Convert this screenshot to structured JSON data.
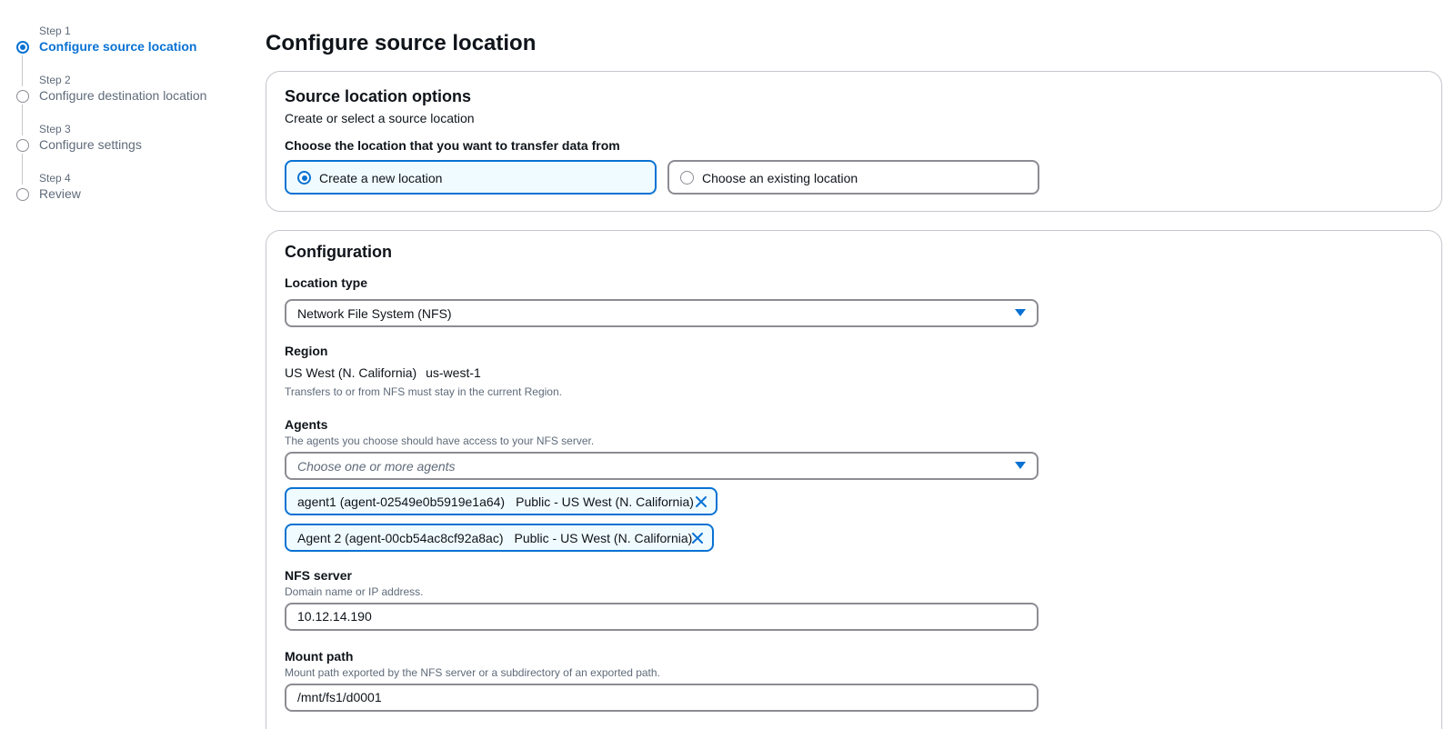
{
  "wizard": {
    "steps": [
      {
        "number": "Step 1",
        "title": "Configure source location",
        "active": true
      },
      {
        "number": "Step 2",
        "title": "Configure destination location",
        "active": false
      },
      {
        "number": "Step 3",
        "title": "Configure settings",
        "active": false
      },
      {
        "number": "Step 4",
        "title": "Review",
        "active": false
      }
    ]
  },
  "page": {
    "title": "Configure source location"
  },
  "source_options": {
    "header": "Source location options",
    "description": "Create or select a source location",
    "choice_label": "Choose the location that you want to transfer data from",
    "tiles": [
      {
        "label": "Create a new location",
        "selected": true
      },
      {
        "label": "Choose an existing location",
        "selected": false
      }
    ]
  },
  "configuration": {
    "header": "Configuration",
    "location_type": {
      "label": "Location type",
      "value": "Network File System (NFS)"
    },
    "region": {
      "label": "Region",
      "name": "US West (N. California)",
      "code": "us-west-1",
      "hint": "Transfers to or from NFS must stay in the current Region."
    },
    "agents": {
      "label": "Agents",
      "hint": "The agents you choose should have access to your NFS server.",
      "placeholder": "Choose one or more agents",
      "tokens": [
        {
          "label": "agent1 (agent-02549e0b5919e1a64)",
          "description": "Public - US West (N. California)"
        },
        {
          "label": "Agent 2 (agent-00cb54ac8cf92a8ac)",
          "description": "Public - US West (N. California)"
        }
      ]
    },
    "nfs_server": {
      "label": "NFS server",
      "hint": "Domain name or IP address.",
      "value": "10.12.14.190"
    },
    "mount_path": {
      "label": "Mount path",
      "hint": "Mount path exported by the NFS server or a subdirectory of an exported path.",
      "value": "/mnt/fs1/d0001"
    }
  },
  "colors": {
    "accent": "#0972d3",
    "selected_bg": "#f0fbff",
    "border": "#8c8c94",
    "container_border": "#c6c6cd",
    "muted_text": "#5f6b7a"
  },
  "icons": {
    "dropdown": "caret-down-icon",
    "remove": "close-icon",
    "step_current": "radio-filled-icon",
    "step_pending": "radio-empty-icon"
  }
}
